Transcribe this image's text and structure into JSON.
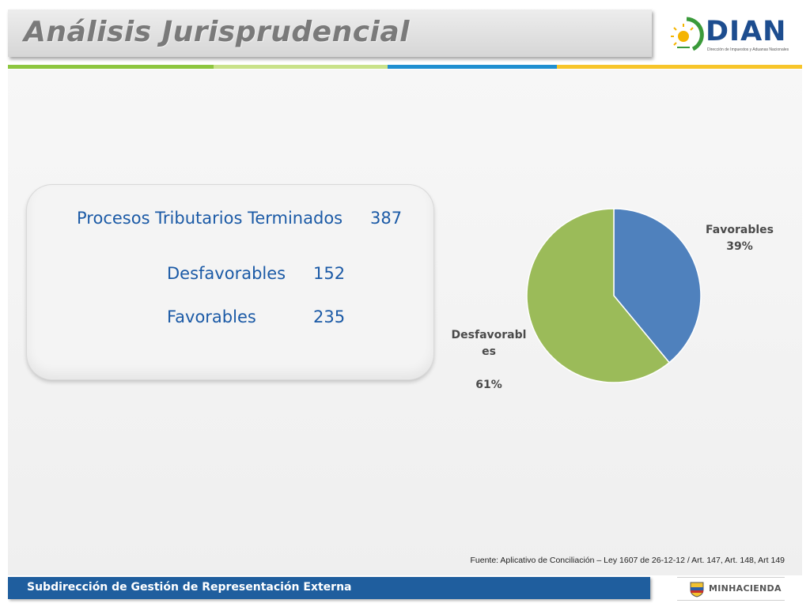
{
  "header": {
    "title": "Análisis Jurisprudencial",
    "logo_text": "DIAN",
    "logo_subtitle": "Dirección de Impuestos y Aduanas Nacionales"
  },
  "colors": {
    "stripe": [
      "#8dc63f",
      "#c9e28a",
      "#1f8fd0",
      "#f7c52a"
    ],
    "favorables": "#4f81bd",
    "desfavorables": "#9bbb59",
    "card_text": "#1b5aa6",
    "footer": "#1f5e9e"
  },
  "summary": {
    "total_label": "Procesos Tributarios Terminados",
    "total_value": "387",
    "rows": [
      {
        "label": "Desfavorables",
        "value": "152"
      },
      {
        "label": "Favorables",
        "value": "235"
      }
    ]
  },
  "chart_data": {
    "type": "pie",
    "title": "",
    "start_angle_deg": 0,
    "direction": "clockwise",
    "slices": [
      {
        "label": "Favorables",
        "percent": 39,
        "value": 152,
        "label_text": "Favorables",
        "percent_text": "39%"
      },
      {
        "label": "Desfavorables",
        "percent": 61,
        "value": 235,
        "label_text": "Desfavorabl\nes",
        "percent_text": "61%"
      }
    ],
    "legend": "none"
  },
  "source_note": "Fuente: Aplicativo de Conciliación – Ley 1607 de 26-12-12 / Art. 147, Art. 148, Art 149",
  "footer": {
    "text": "Subdirección de Gestión de Representación Externa",
    "ministry_logo": "MINHACIENDA"
  }
}
